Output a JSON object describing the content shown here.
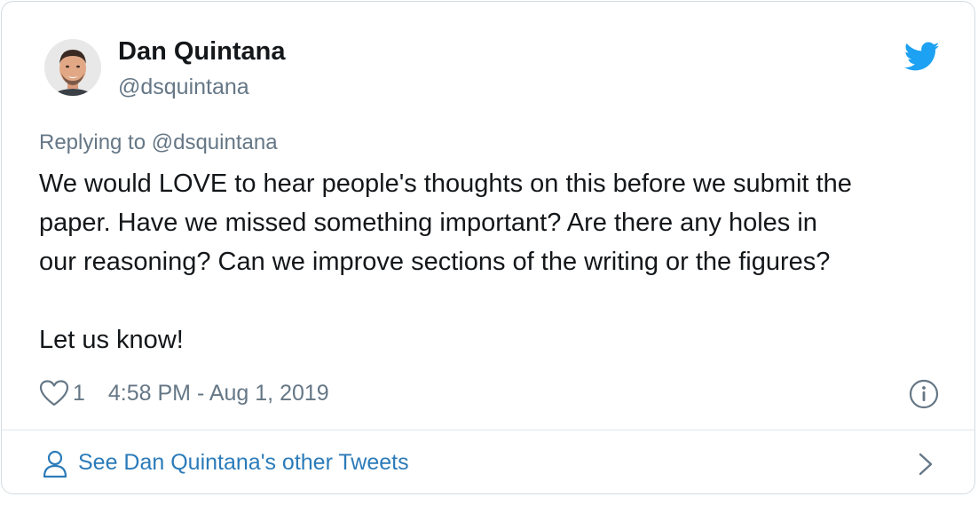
{
  "author": {
    "name": "Dan Quintana",
    "handle": "@dsquintana"
  },
  "reply": {
    "label": "Replying to @dsquintana"
  },
  "tweet": {
    "lines": [
      "We would LOVE to hear people's thoughts on this before we submit the",
      "paper. Have we missed something important? Are there any holes in",
      "our reasoning? Can we improve sections of the writing or the figures?",
      "",
      "Let us know!"
    ]
  },
  "meta": {
    "likes": "1",
    "timestamp": "4:58 PM - Aug 1, 2019"
  },
  "footer": {
    "other_tweets_label": "See Dan Quintana's other Tweets"
  },
  "colors": {
    "twitter_blue": "#1da1f2",
    "link_blue": "#2b7bb9",
    "secondary_text": "#657786",
    "primary_text": "#14171a"
  },
  "icons": {
    "brand": "twitter-bird-icon",
    "like": "heart-icon",
    "info": "info-icon",
    "profile": "person-icon",
    "more": "chevron-right-icon"
  }
}
